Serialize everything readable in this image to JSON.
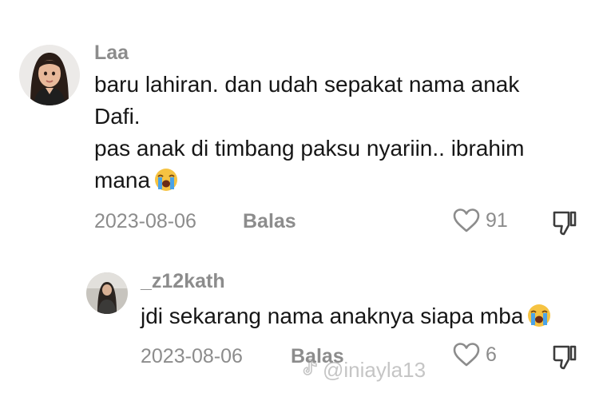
{
  "comment": {
    "username": "Laa",
    "text_lines": [
      "baru lahiran. dan udah sepakat nama anak",
      "Dafi.",
      "pas anak di timbang paksu nyariin.. ibrahim",
      "mana"
    ],
    "emoji": "loudly-crying-face-icon",
    "date": "2023-08-06",
    "reply_label": "Balas",
    "like_count": "91"
  },
  "reply": {
    "username": "_z12kath",
    "text": "jdi sekarang nama anaknya siapa mba",
    "emoji": "loudly-crying-face-icon",
    "date": "2023-08-06",
    "reply_label": "Balas",
    "like_count": "6"
  },
  "watermark": {
    "text": "@iniayla13",
    "icon": "tiktok-logo-icon"
  },
  "colors": {
    "text_primary": "#161616",
    "text_secondary": "#8c8c8c",
    "background": "#ffffff"
  }
}
